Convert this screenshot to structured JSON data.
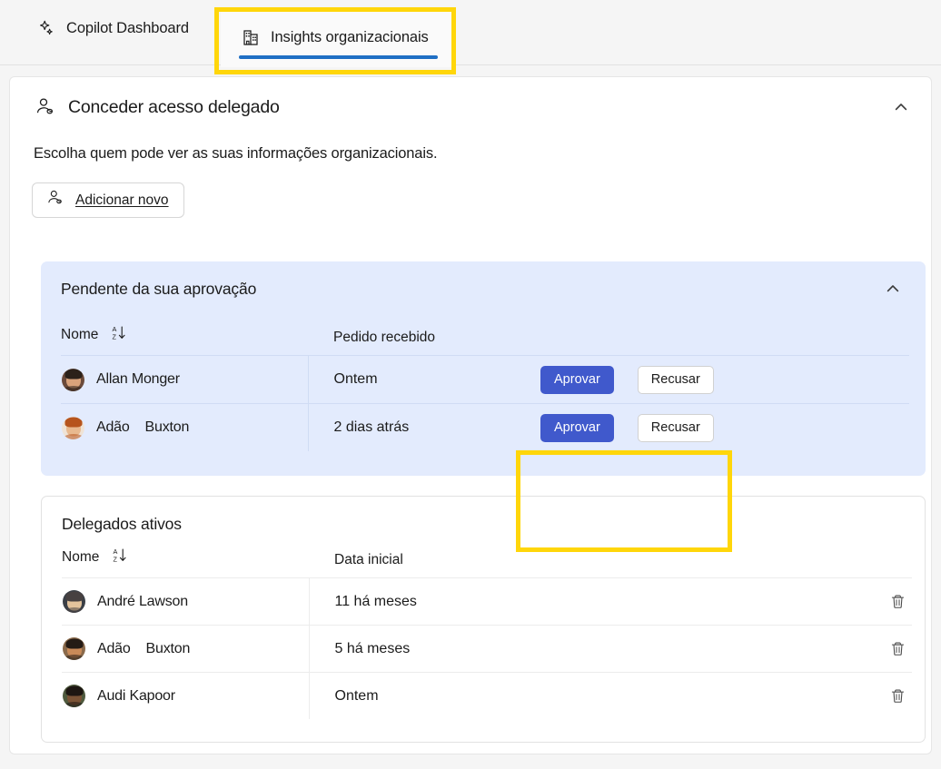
{
  "tabs": [
    {
      "id": "copilot",
      "label": "Copilot Dashboard",
      "icon": "sparkle-icon",
      "active": false
    },
    {
      "id": "insights",
      "label": "Insights organizacionais",
      "icon": "organization-building-icon",
      "active": true
    }
  ],
  "section": {
    "title": "Conceder acesso delegado",
    "icon": "person-link-icon",
    "collapse_icon": "chevron-up-icon",
    "description": "Escolha quem pode ver as suas informações organizacionais.",
    "add_button": {
      "label": "Adicionar novo",
      "icon": "person-link-icon"
    }
  },
  "pending": {
    "title": "Pendente da sua aprovação",
    "collapse_icon": "chevron-up-icon",
    "columns": [
      "Nome",
      "Pedido recebido"
    ],
    "sort_icon": "sort-az-descending-icon",
    "rows": [
      {
        "name": "Allan Monger",
        "received": "Ontem",
        "approve_label": "Aprovar",
        "decline_label": "Recusar"
      },
      {
        "name": "Adão    Buxton",
        "received": "2 dias atrás",
        "approve_label": "Aprovar",
        "decline_label": "Recusar"
      }
    ]
  },
  "active": {
    "title": "Delegados ativos",
    "columns": [
      "Nome",
      "Data inicial"
    ],
    "sort_icon": "sort-az-descending-icon",
    "delete_icon": "trash-icon",
    "rows": [
      {
        "name": "André Lawson",
        "start": "11 há meses"
      },
      {
        "name": "Adão    Buxton",
        "start": "5 há meses"
      },
      {
        "name": "Audi Kapoor",
        "start": "Ontem"
      }
    ]
  },
  "colors": {
    "accent_blue": "#1f6fc4",
    "primary_button": "#4059cc",
    "highlight_yellow": "#ffd60a",
    "pending_panel_bg": "#e3ebfd",
    "page_bg": "#f5f5f5"
  }
}
